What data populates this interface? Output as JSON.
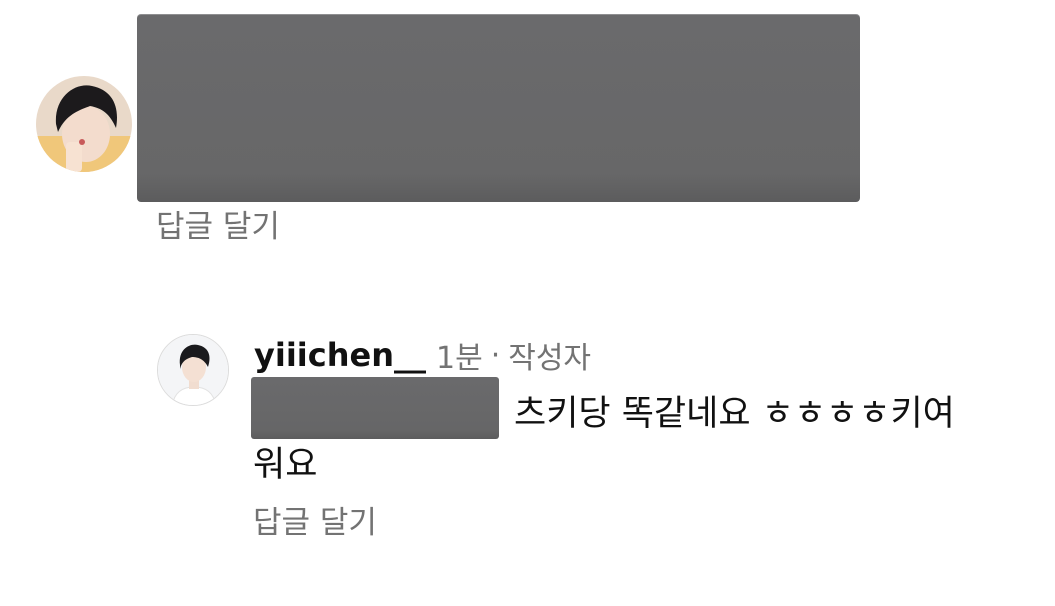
{
  "comments": [
    {
      "avatar": "user-avatar-photo",
      "text": "",
      "redacted": true,
      "reply_label": "답글 달기"
    },
    {
      "avatar": "author-avatar-photo",
      "username": "yiiichen__",
      "time": "1분",
      "separator": "·",
      "author_badge": "작성자",
      "text_line1": "츠키당 똑같네요 ㅎㅎㅎㅎ키여",
      "text_line2": "워요",
      "redacted_mention": true,
      "reply_label": "답글 달기"
    }
  ],
  "colors": {
    "secondary_text": "#737373",
    "primary_text": "#111111",
    "redaction": "#676768"
  }
}
